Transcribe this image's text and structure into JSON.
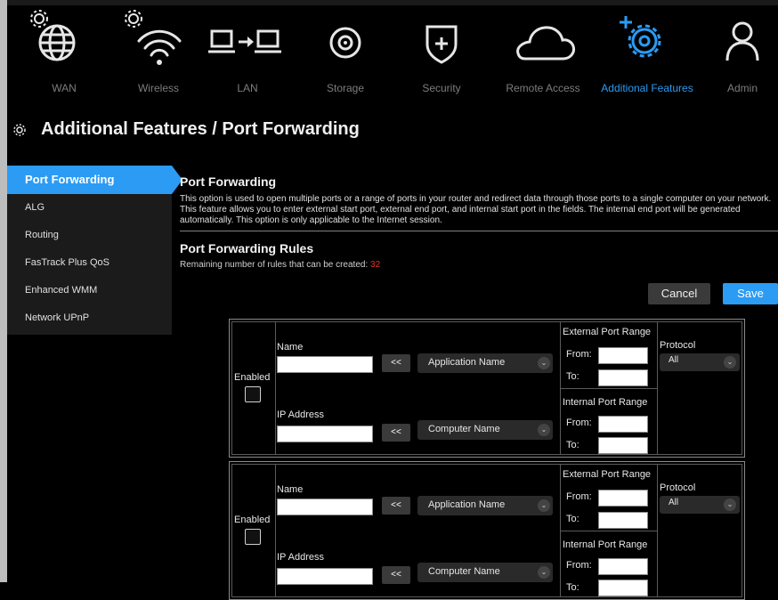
{
  "nav": {
    "items": [
      {
        "label": "WAN",
        "icon": "globe-icon"
      },
      {
        "label": "Wireless",
        "icon": "wifi-icon"
      },
      {
        "label": "LAN",
        "icon": "lan-icon"
      },
      {
        "label": "Storage",
        "icon": "storage-icon"
      },
      {
        "label": "Security",
        "icon": "shield-icon"
      },
      {
        "label": "Remote Access",
        "icon": "cloud-icon"
      },
      {
        "label": "Additional Features",
        "icon": "gears-plus-icon"
      },
      {
        "label": "Admin",
        "icon": "user-icon"
      }
    ],
    "active_index": 6,
    "active_color": "#2b9bf4"
  },
  "page": {
    "title": "Additional Features / Port Forwarding"
  },
  "sidebar": {
    "items": [
      {
        "label": "Port Forwarding"
      },
      {
        "label": "ALG"
      },
      {
        "label": "Routing"
      },
      {
        "label": "FasTrack Plus QoS"
      },
      {
        "label": "Enhanced WMM"
      },
      {
        "label": "Network UPnP"
      }
    ]
  },
  "port_forwarding": {
    "title": "Port Forwarding",
    "description": "This option is used to open multiple ports or a range of ports in your router and redirect data through those ports to a single computer on your network. This feature allows you to enter external start port, external end port, and internal start port in the fields. The internal end port will be generated automatically. This option is only applicable to the Internet session."
  },
  "rules": {
    "title": "Port Forwarding Rules",
    "remaining_label": "Remaining number of rules that can be created: ",
    "remaining_count": "32",
    "cancel_label": "Cancel",
    "save_label": "Save"
  },
  "rule_form": {
    "enabled_label": "Enabled",
    "name_label": "Name",
    "ip_label": "IP Address",
    "arrow_label": "<<",
    "application_dropdown": "Application Name",
    "computer_dropdown": "Computer Name",
    "external_range_label": "External Port Range",
    "internal_range_label": "Internal Port Range",
    "from_label": "From:",
    "to_label": "To:",
    "protocol_label": "Protocol",
    "protocol_value": "All"
  }
}
